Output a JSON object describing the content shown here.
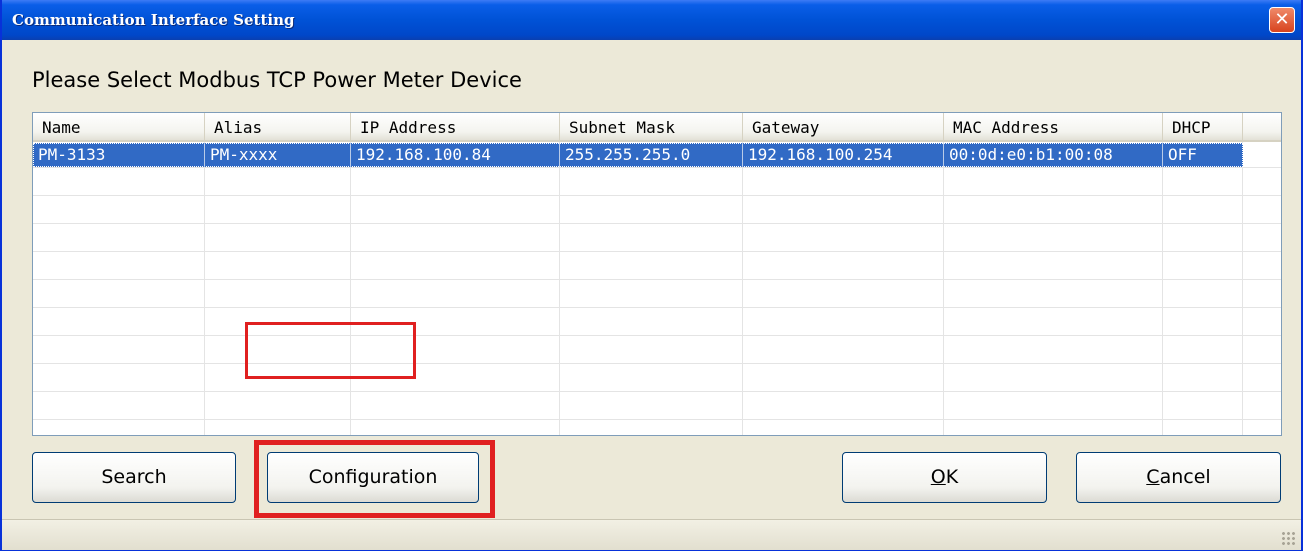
{
  "window": {
    "title": "Communication Interface Setting",
    "close_glyph": "✕"
  },
  "prompt": "Please Select Modbus TCP Power Meter Device",
  "device_list": {
    "columns": [
      "Name",
      "Alias",
      "IP Address",
      "Subnet Mask",
      "Gateway",
      "MAC Address",
      "DHCP"
    ],
    "rows": [
      {
        "name": "PM-3133",
        "alias": "PM-xxxx",
        "ip": "192.168.100.84",
        "subnet": "255.255.255.0",
        "gateway": "192.168.100.254",
        "mac": "00:0d:e0:b1:00:08",
        "dhcp": "OFF",
        "selected": true
      }
    ]
  },
  "buttons": {
    "search": "Search",
    "configuration": "Configuration",
    "ok": "OK",
    "ok_mnemonic": "O",
    "cancel": "Cancel",
    "cancel_mnemonic": "C"
  },
  "colors": {
    "title_bar": "#0052d6",
    "selection": "#316ac5",
    "annotation": "#e02020"
  }
}
